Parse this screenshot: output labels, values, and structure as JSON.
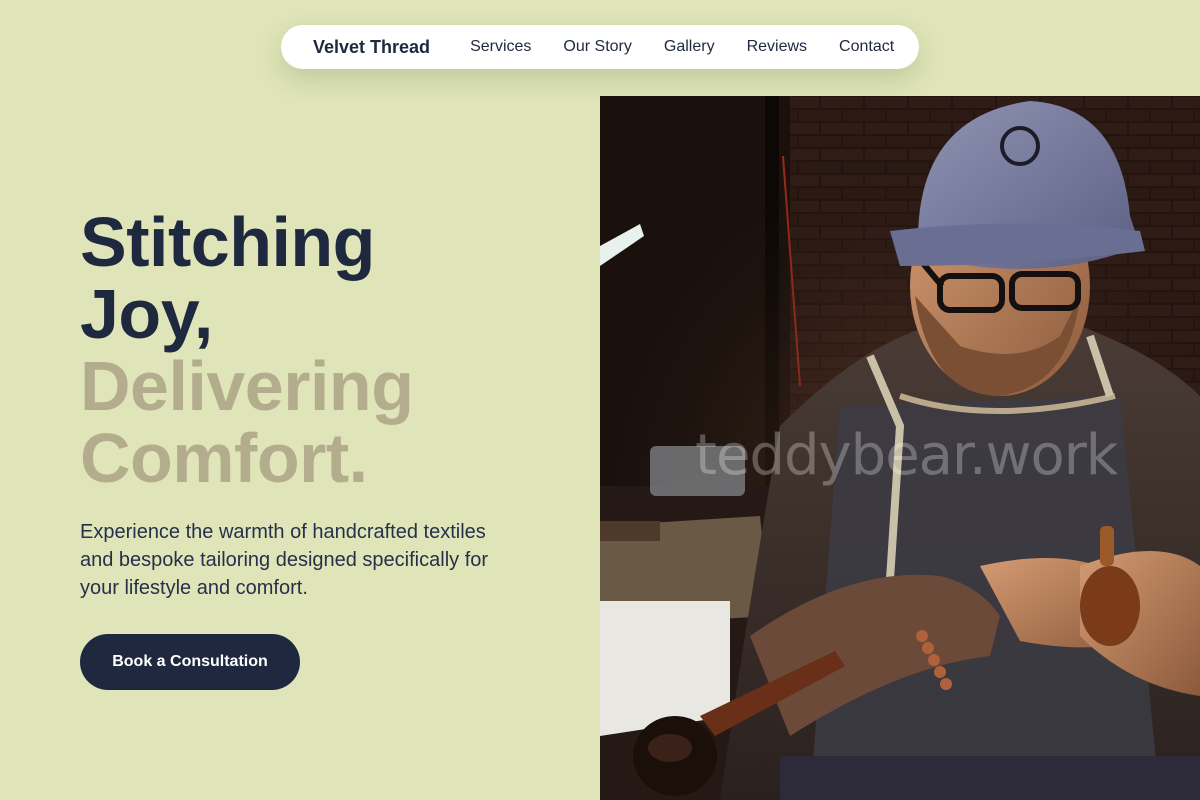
{
  "nav": {
    "brand": "Velvet Thread",
    "links": [
      "Services",
      "Our Story",
      "Gallery",
      "Reviews",
      "Contact"
    ]
  },
  "hero": {
    "title_lines": [
      "Stitching",
      "Joy,",
      "Delivering",
      "Comfort."
    ],
    "subtitle": "Experience the warmth of handcrafted textiles and bespoke tailoring designed specifically for your lifestyle and comfort.",
    "cta_label": "Book a Consultation",
    "image_watermark": "teddybear.work"
  },
  "colors": {
    "page_background": "#dfe5b8",
    "primary_dark": "#1e2940",
    "muted_title": "#b3ad8e",
    "nav_background": "#ffffff"
  }
}
